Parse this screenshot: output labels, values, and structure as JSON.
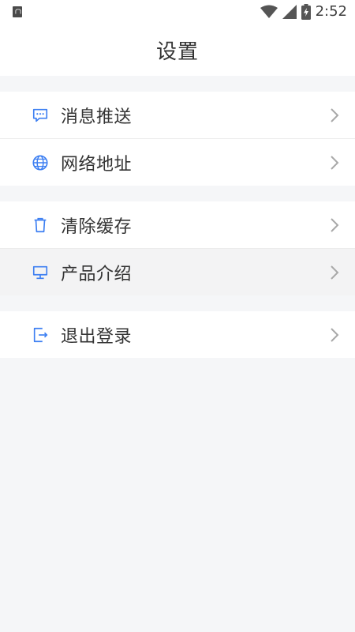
{
  "status_bar": {
    "time": "2:52",
    "left_icon": "app-notification-icon",
    "icons": [
      "wifi-icon",
      "signal-icon",
      "battery-charging-icon"
    ]
  },
  "header": {
    "title": "设置"
  },
  "colors": {
    "accent": "#3d7ff2",
    "background": "#f5f6f8",
    "text": "#333333",
    "chevron": "#a8a8a8"
  },
  "groups": [
    {
      "items": [
        {
          "label": "消息推送",
          "icon": "message-icon"
        },
        {
          "label": "网络地址",
          "icon": "globe-icon"
        }
      ]
    },
    {
      "items": [
        {
          "label": "清除缓存",
          "icon": "trash-icon"
        },
        {
          "label": "产品介绍",
          "icon": "monitor-icon"
        }
      ]
    },
    {
      "items": [
        {
          "label": "退出登录",
          "icon": "logout-icon"
        }
      ]
    }
  ]
}
